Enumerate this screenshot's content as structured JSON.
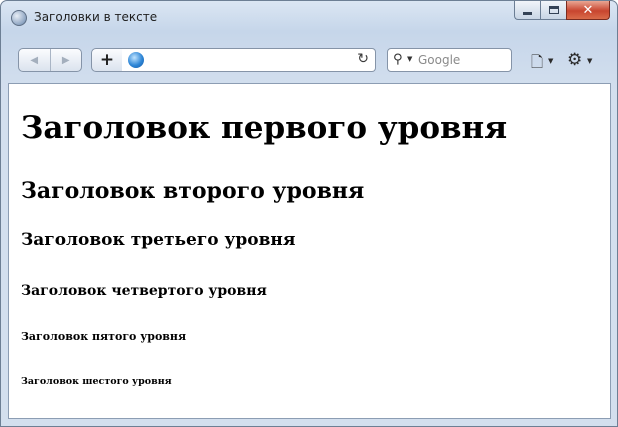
{
  "window": {
    "title": "Заголовки в тексте"
  },
  "toolbar": {
    "add_label": "+",
    "address_value": "",
    "search_placeholder": "Google"
  },
  "content": {
    "h1": "Заголовок первого уровня",
    "h2": "Заголовок второго уровня",
    "h3": "Заголовок третьего уровня",
    "h4": "Заголовок четвертого уровня",
    "h5": "Заголовок пятого уровня",
    "h6": "Заголовок шестого уровня"
  },
  "icons": {
    "app": "browser-app-icon",
    "back": "back-arrow-icon",
    "forward": "forward-arrow-icon",
    "globe": "globe-icon",
    "reload": "reload-icon",
    "search": "search-icon",
    "page": "page-menu-icon",
    "tools": "gear-icon"
  },
  "colors": {
    "frame": "#c6d6ea",
    "close_button": "#c8452f",
    "content_bg": "#ffffff",
    "text": "#000000"
  }
}
